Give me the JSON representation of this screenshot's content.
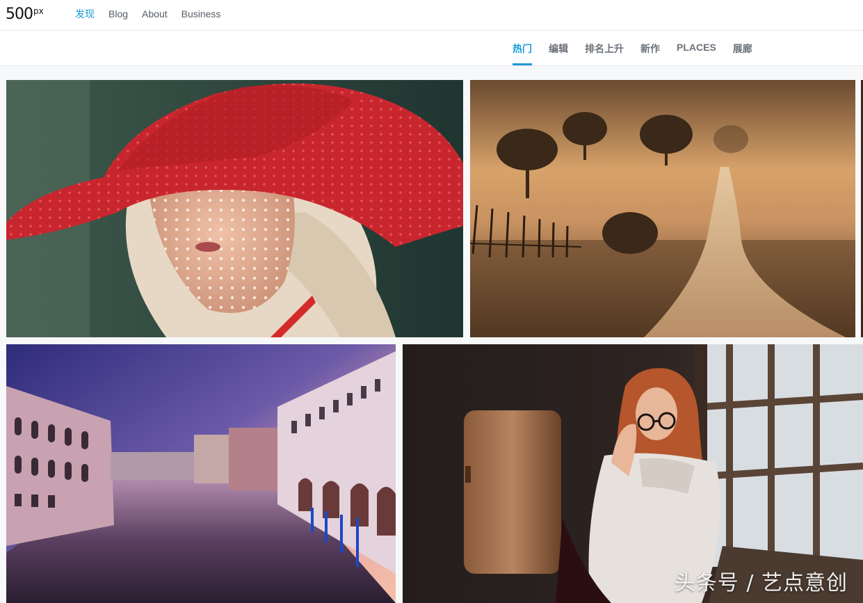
{
  "brand": {
    "logo_main": "500",
    "logo_sup": "px"
  },
  "nav": {
    "items": [
      {
        "label": "发现",
        "active": true
      },
      {
        "label": "Blog",
        "active": false
      },
      {
        "label": "About",
        "active": false
      },
      {
        "label": "Business",
        "active": false
      }
    ]
  },
  "tabs": {
    "items": [
      {
        "label": "热门",
        "active": true
      },
      {
        "label": "编辑",
        "active": false
      },
      {
        "label": "排名上升",
        "active": false
      },
      {
        "label": "新作",
        "active": false
      },
      {
        "label": "PLACES",
        "active": false
      },
      {
        "label": "展廊",
        "active": false
      }
    ]
  },
  "watermark": "头条号 / 艺点意创",
  "colors": {
    "accent": "#1a9ad6",
    "nav_text": "#555c66",
    "tab_text": "#6c727a"
  }
}
